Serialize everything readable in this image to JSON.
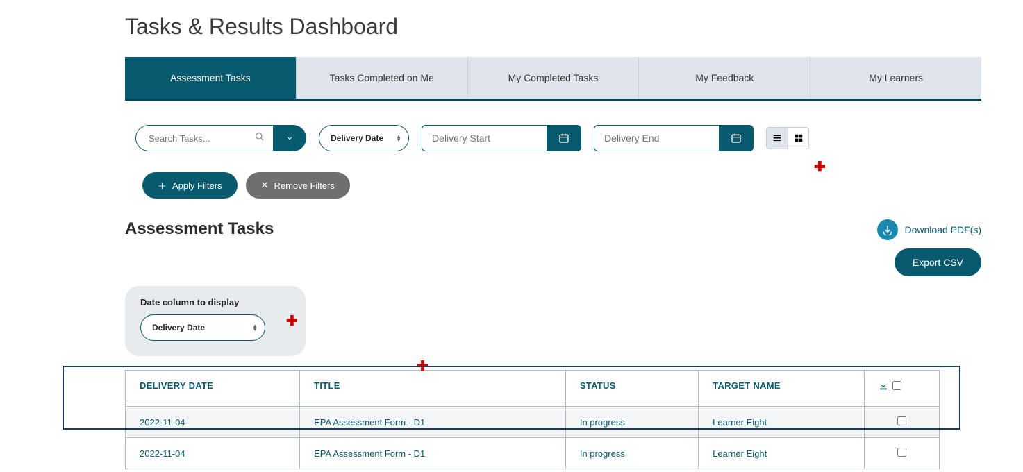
{
  "page": {
    "title": "Tasks & Results Dashboard"
  },
  "tabs": [
    {
      "label": "Assessment Tasks",
      "active": true
    },
    {
      "label": "Tasks Completed on Me",
      "active": false
    },
    {
      "label": "My Completed Tasks",
      "active": false
    },
    {
      "label": "My Feedback",
      "active": false
    },
    {
      "label": "My Learners",
      "active": false
    }
  ],
  "filters": {
    "search_placeholder": "Search Tasks...",
    "delivery_type_label": "Delivery Date",
    "delivery_start_placeholder": "Delivery Start",
    "delivery_end_placeholder": "Delivery End",
    "apply_label": "Apply Filters",
    "remove_label": "Remove Filters"
  },
  "section": {
    "title": "Assessment Tasks",
    "download_pdf_label": "Download PDF(s)",
    "export_csv_label": "Export CSV",
    "date_column_title": "Date column to display",
    "date_column_value": "Delivery Date"
  },
  "table": {
    "columns": {
      "delivery_date": "DELIVERY DATE",
      "title": "TITLE",
      "status": "STATUS",
      "target_name": "TARGET NAME"
    },
    "rows": [
      {
        "date": "2022-11-04",
        "title": "EPA Assessment Form - D1",
        "status": "In progress",
        "target": "Learner Eight"
      },
      {
        "date": "2022-11-04",
        "title": "EPA Assessment Form - D1",
        "status": "In progress",
        "target": "Learner Eight"
      }
    ]
  },
  "markers": {
    "plus": "✚"
  }
}
